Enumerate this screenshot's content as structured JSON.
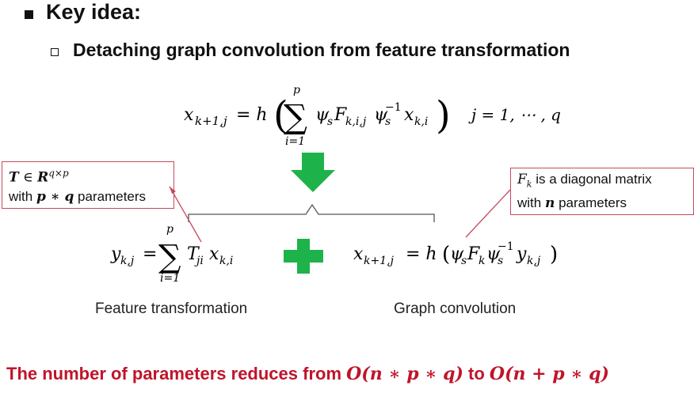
{
  "heading": "Key idea:",
  "subheading": "Detaching graph convolution from feature transformation",
  "formula_top": {
    "lhs": "x",
    "lhs_sub": "k+1,j",
    "eq": "= h",
    "sum_top": "p",
    "sum_bottom": "i=1",
    "body": "ψ",
    "body_s1": "s",
    "body_F": "F",
    "body_F_sub": "k,i,j",
    "body_psi2": "ψ",
    "body_s2": "s",
    "body_sup": "−1",
    "body_x": "x",
    "body_x_sub": "k,i",
    "range": "j = 1, ⋯ , q"
  },
  "callout_left": {
    "line1_T": "T",
    "line1_in": " ∈ ",
    "line1_R": "R",
    "line1_sup": "q×p",
    "line2_pre": "with ",
    "line2_expr": "p ∗ q",
    "line2_post": " parameters"
  },
  "callout_right": {
    "line1_F": "F",
    "line1_sub": "k",
    "line1_text": " is a diagonal matrix",
    "line2_pre": "with ",
    "line2_n": "n",
    "line2_post": " parameters"
  },
  "formula_left": {
    "lhs": "y",
    "lhs_sub": "k,j",
    "eq": "=",
    "sum_top": "p",
    "sum_bottom": "i=1",
    "T": "T",
    "T_sub": "ji",
    "x": "x",
    "x_sub": "k,i"
  },
  "formula_right": {
    "lhs": "x",
    "lhs_sub": "k+1,j",
    "eq": "= h",
    "psi": "ψ",
    "s1": "s",
    "F": "F",
    "F_sub": "k",
    "psi2": "ψ",
    "s2": "s",
    "sup": "−1",
    "y": "y",
    "y_sub": "k,j"
  },
  "caption_left": "Feature transformation",
  "caption_right": "Graph convolution",
  "bottom": {
    "text1": "The number of parameters reduces from ",
    "expr1": "O(n ∗ p ∗ q)",
    "text2": " to ",
    "expr2": "O(n + p ∗ q)"
  },
  "colors": {
    "green": "#1db34a",
    "callout_border": "#c44a5e",
    "bottom_text": "#c0142a"
  }
}
